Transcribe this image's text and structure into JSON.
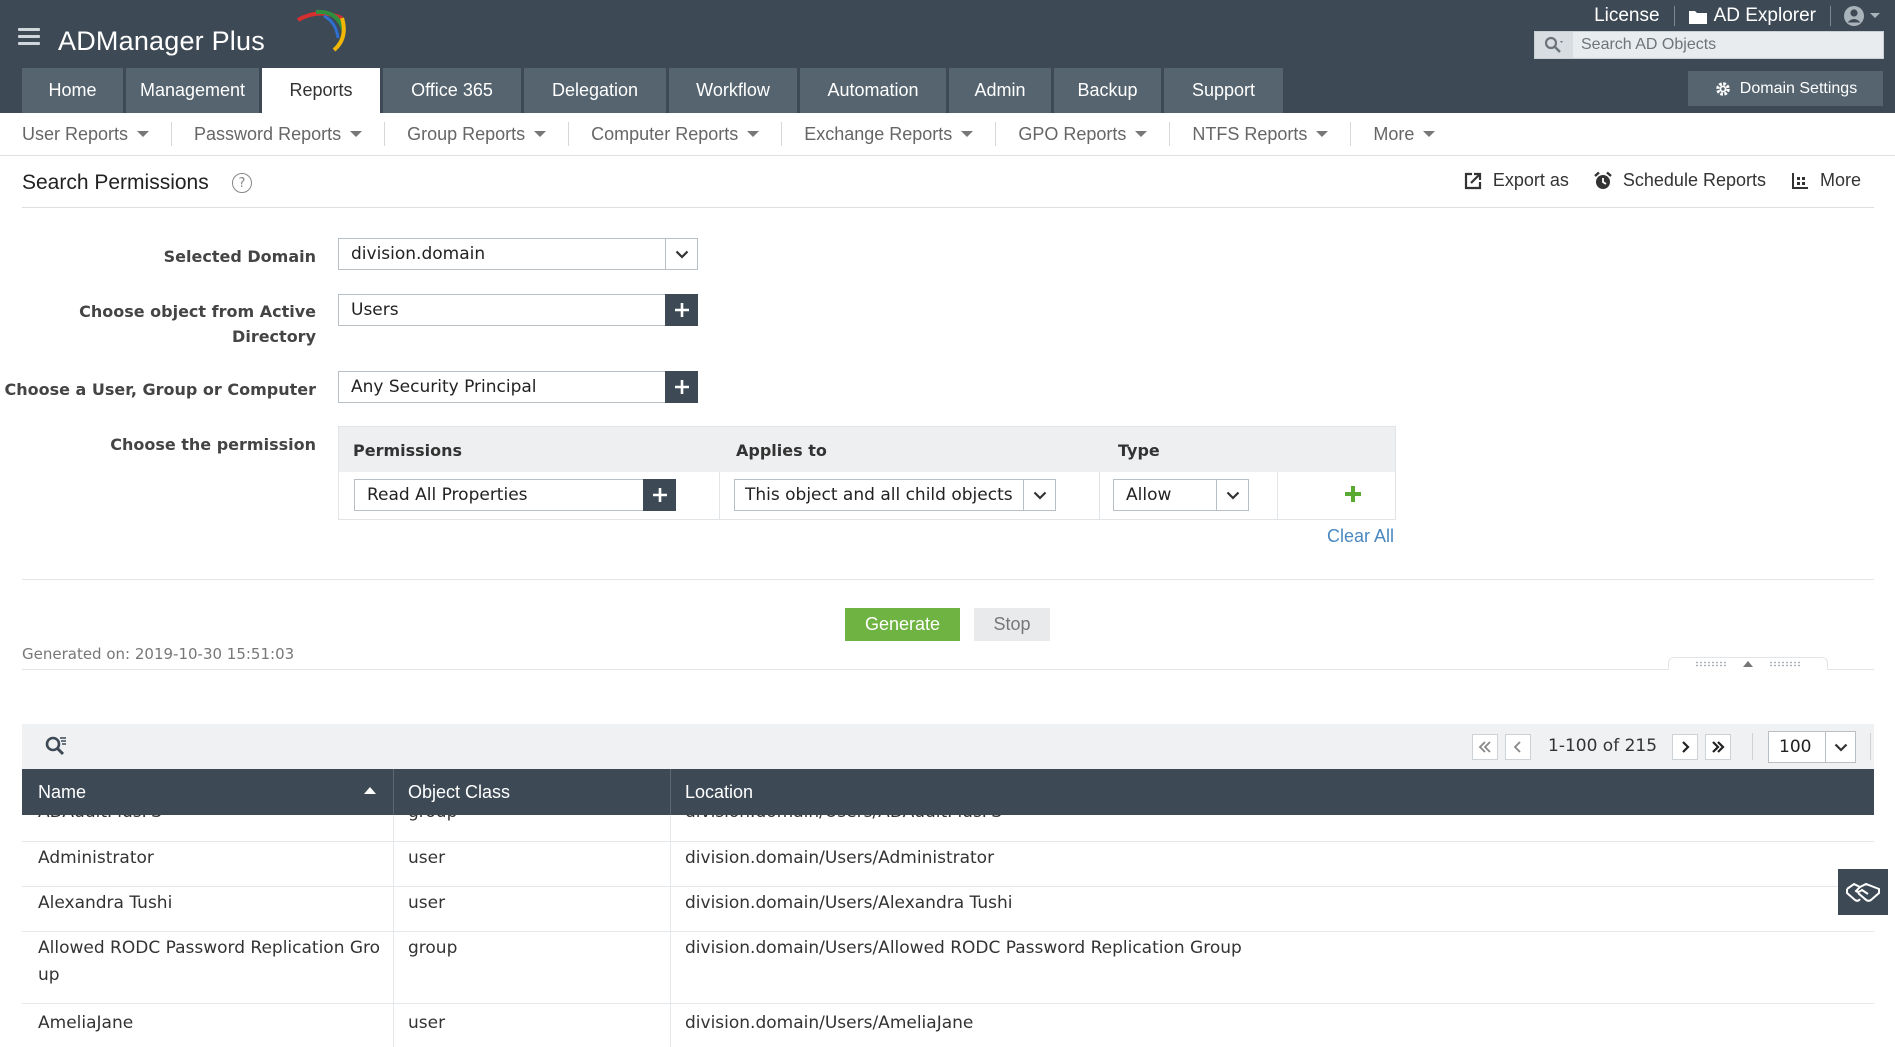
{
  "app": {
    "logo_text": "ADManager Plus"
  },
  "header": {
    "license_label": "License",
    "ad_explorer_label": "AD Explorer",
    "search": {
      "placeholder": "Search AD Objects"
    },
    "domain_settings_label": "Domain Settings"
  },
  "tabs": [
    {
      "label": "Home"
    },
    {
      "label": "Management"
    },
    {
      "label": "Reports",
      "active": true
    },
    {
      "label": "Office 365"
    },
    {
      "label": "Delegation"
    },
    {
      "label": "Workflow"
    },
    {
      "label": "Automation"
    },
    {
      "label": "Admin"
    },
    {
      "label": "Backup"
    },
    {
      "label": "Support"
    }
  ],
  "subnav": [
    {
      "label": "User Reports"
    },
    {
      "label": "Password Reports"
    },
    {
      "label": "Group Reports"
    },
    {
      "label": "Computer Reports"
    },
    {
      "label": "Exchange Reports"
    },
    {
      "label": "GPO Reports"
    },
    {
      "label": "NTFS Reports"
    },
    {
      "label": "More"
    }
  ],
  "page": {
    "title": "Search Permissions",
    "help_glyph": "?",
    "actions": {
      "export_label": "Export as",
      "schedule_label": "Schedule Reports",
      "more_label": "More"
    }
  },
  "form": {
    "selected_domain": {
      "label": "Selected Domain",
      "value": "division.domain"
    },
    "ad_object": {
      "label_line1": "Choose object from Active",
      "label_line2": "Directory",
      "value": "Users"
    },
    "principal": {
      "label": "Choose a User, Group or Computer",
      "value": "Any Security Principal"
    },
    "permission": {
      "label": "Choose the permission",
      "headers": {
        "permissions": "Permissions",
        "applies_to": "Applies to",
        "type": "Type"
      },
      "row": {
        "permission": "Read All Properties",
        "applies_to": "This object and all child objects",
        "type": "Allow"
      },
      "clear_all_label": "Clear All"
    },
    "generate_label": "Generate",
    "stop_label": "Stop"
  },
  "results": {
    "generated_on": "Generated on: 2019-10-30 15:51:03",
    "pagination": {
      "range_text": "1-100 of 215",
      "page_size": "100"
    },
    "columns": {
      "name": "Name",
      "object_class": "Object Class",
      "location": "Location"
    },
    "sort": {
      "column": "name",
      "direction": "ascending"
    },
    "rows": [
      {
        "name": "ADAuditPlusFS",
        "object_class": "group",
        "location": "division.domain/Users/ADAuditPlusFS"
      },
      {
        "name": "Administrator",
        "object_class": "user",
        "location": "division.domain/Users/Administrator"
      },
      {
        "name": "Alexandra Tushi",
        "object_class": "user",
        "location": "division.domain/Users/Alexandra Tushi"
      },
      {
        "name": "Allowed RODC Password Replication Group",
        "object_class": "group",
        "location": "division.domain/Users/Allowed RODC Password Replication Group"
      },
      {
        "name": "AmeliaJane",
        "object_class": "user",
        "location": "division.domain/Users/AmeliaJane"
      }
    ]
  },
  "colors": {
    "header_bg": "#3d4a55",
    "tab_bg": "#55646f",
    "generate_green": "#6fb342",
    "link_blue": "#4a88c0"
  }
}
